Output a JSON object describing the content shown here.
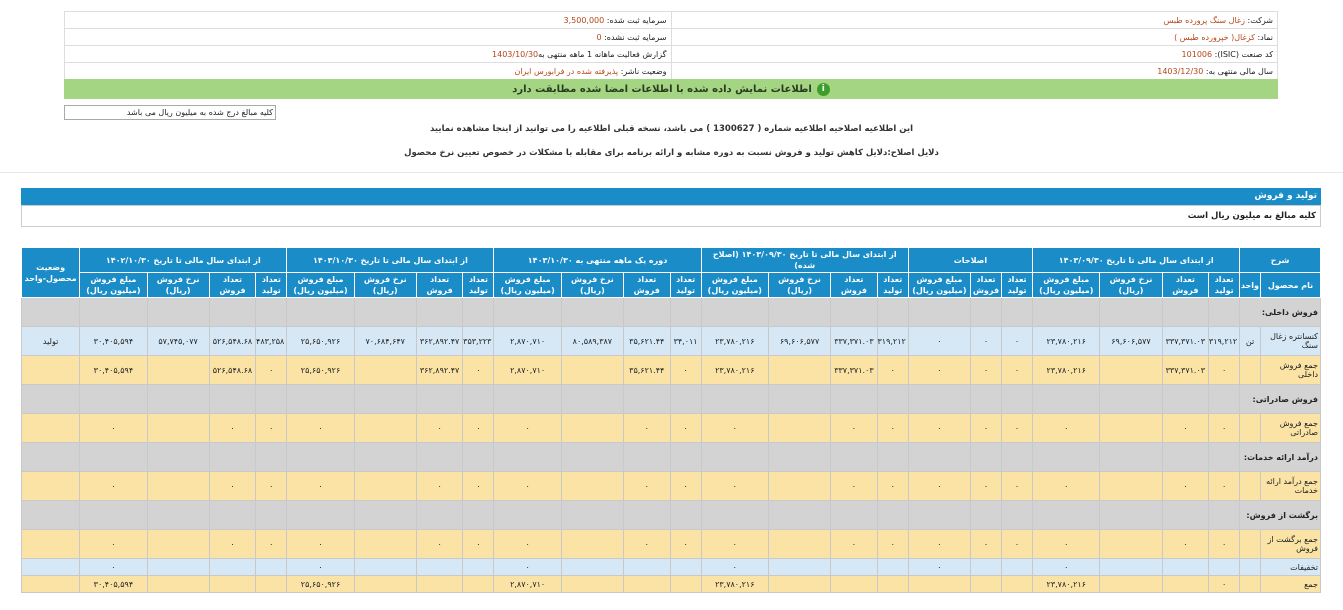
{
  "header": {
    "company_label": "شرکت:",
    "company_value": "زغال سنگ پرورده طبس",
    "capital_reg_label": "سرمایه ثبت شده:",
    "capital_reg_value": "3,500,000",
    "symbol_label": "نماد:",
    "symbol_value": "کزغال( خپرورده طبس )",
    "capital_unreg_label": "سرمایه ثبت نشده:",
    "capital_unreg_value": "0",
    "isic_label": "کد صنعت (ISIC):",
    "isic_value": "101006",
    "report_label": "گزارش فعالیت ماهانه 1 ماهه منتهی به",
    "report_value": "1403/10/30",
    "fiscal_label": "سال مالی منتهی به:",
    "fiscal_value": "1403/12/30",
    "status_label": "وضعیت ناشر:",
    "status_value": "پذیرفته شده در فرابورس ایران"
  },
  "notice": {
    "icon": "info-icon",
    "text": "اطلاعات نمایش داده شده با اطلاعات امضا شده مطابقت دارد"
  },
  "unit_box": "کلیه مبالغ درج شده به میلیون ریال می باشد",
  "correction_note": "این اطلاعیه اصلاحیه اطلاعیه شماره ( 1300627 ) می باشد، نسخه قبلی اطلاعیه را می توانید از اینجا مشاهده نمایید",
  "correction_reason": "دلایل اصلاح:دلایل کاهش تولید و فروش نسبت به دوره مشابه و ارائه برنامه برای مقابله با مشکلات در خصوص تعیین نرخ محصول",
  "section": {
    "title": "تولید و فروش",
    "subtitle": "کلیه مبالغ به میلیون ریال است"
  },
  "table": {
    "col_sharh": "شرح",
    "col_name": "نام محصول",
    "col_unit": "واحد",
    "groups": [
      "از ابتدای سال مالی تا تاریخ ۱۴۰۳/۰۹/۳۰",
      "اصلاحات",
      "از ابتدای سال مالی تا تاریخ ۱۴۰۳/۰۹/۳۰ (اصلاح شده)",
      "دوره یک ماهه منتهی به ۱۴۰۳/۱۰/۳۰",
      "از ابتدای سال مالی تا تاریخ ۱۴۰۳/۱۰/۳۰",
      "از ابتدای سال مالی تا تاریخ ۱۴۰۲/۱۰/۳۰",
      "وضعیت محصول-واحد"
    ],
    "sub4": [
      "تعداد تولید",
      "تعداد فروش",
      "نرخ فروش (ریال)",
      "مبلغ فروش (میلیون ریال)"
    ],
    "sub3": [
      "تعداد تولید",
      "تعداد فروش",
      "مبلغ فروش (میلیون ریال)"
    ],
    "rows": [
      {
        "kind": "group",
        "label": "فروش داخلی:",
        "cells": []
      },
      {
        "kind": "blue",
        "label": "کنسانتره زغال سنگ",
        "unit": "تن",
        "cells": [
          "۳۱۹,۲۱۲",
          "۳۳۷,۳۷۱.۰۳",
          "۶۹,۶۰۶,۵۷۷",
          "۲۳,۷۸۰,۲۱۶",
          "۰",
          "۰",
          "۰",
          "۳۱۹,۲۱۲",
          "۳۳۷,۳۷۱.۰۳",
          "۶۹,۶۰۶,۵۷۷",
          "۲۳,۷۸۰,۲۱۶",
          "۳۴,۰۱۱",
          "۳۵,۶۲۱.۴۴",
          "۸۰,۵۸۹,۳۸۷",
          "۲,۸۷۰,۷۱۰",
          "۳۵۳,۲۲۳",
          "۳۶۲,۸۹۲.۴۷",
          "۷۰,۶۸۴,۶۴۷",
          "۲۵,۶۵۰,۹۲۶",
          "۴۸۳,۲۵۸",
          "۵۲۶,۵۴۸.۶۸",
          "۵۷,۷۴۵,۰۷۷",
          "۳۰,۴۰۵,۵۹۴",
          "تولید"
        ]
      },
      {
        "kind": "yellow",
        "label": "جمع فروش داخلی",
        "unit": "",
        "cells": [
          "۰",
          "۳۳۷,۳۷۱.۰۳",
          "",
          "۲۳,۷۸۰,۲۱۶",
          "۰",
          "۰",
          "۰",
          "۰",
          "۳۳۷,۳۷۱.۰۳",
          "",
          "۲۳,۷۸۰,۲۱۶",
          "۰",
          "۳۵,۶۲۱.۴۴",
          "",
          "۲,۸۷۰,۷۱۰",
          "۰",
          "۳۶۲,۸۹۲.۴۷",
          "",
          "۲۵,۶۵۰,۹۲۶",
          "۰",
          "۵۲۶,۵۴۸.۶۸",
          "",
          "۳۰,۴۰۵,۵۹۴",
          ""
        ]
      },
      {
        "kind": "group",
        "label": "فروش صادراتی:",
        "cells": []
      },
      {
        "kind": "yellow",
        "label": "جمع فروش صادراتی",
        "unit": "",
        "cells": [
          "۰",
          "۰",
          "",
          "۰",
          "۰",
          "۰",
          "۰",
          "۰",
          "۰",
          "",
          "۰",
          "۰",
          "۰",
          "",
          "۰",
          "۰",
          "۰",
          "",
          "۰",
          "۰",
          "۰",
          "",
          "۰",
          ""
        ]
      },
      {
        "kind": "group",
        "label": "درآمد ارائه خدمات:",
        "cells": []
      },
      {
        "kind": "yellow",
        "label": "جمع درآمد ارائه خدمات",
        "unit": "",
        "cells": [
          "۰",
          "۰",
          "",
          "۰",
          "۰",
          "۰",
          "۰",
          "۰",
          "۰",
          "",
          "۰",
          "۰",
          "۰",
          "",
          "۰",
          "۰",
          "۰",
          "",
          "۰",
          "۰",
          "۰",
          "",
          "۰",
          ""
        ]
      },
      {
        "kind": "group",
        "label": "برگشت از فروش:",
        "cells": []
      },
      {
        "kind": "yellow",
        "label": "جمع برگشت از فروش",
        "unit": "",
        "cells": [
          "۰",
          "۰",
          "",
          "۰",
          "۰",
          "۰",
          "۰",
          "۰",
          "۰",
          "",
          "۰",
          "۰",
          "۰",
          "",
          "۰",
          "۰",
          "۰",
          "",
          "۰",
          "۰",
          "۰",
          "",
          "۰",
          ""
        ]
      },
      {
        "kind": "blue short",
        "label": "تخفیفات",
        "unit": "",
        "cells": [
          "",
          "",
          "",
          "۰",
          "",
          "",
          "۰",
          "",
          "",
          "",
          "۰",
          "",
          "",
          "",
          "۰",
          "",
          "",
          "",
          "۰",
          "",
          "",
          "",
          "۰",
          ""
        ]
      },
      {
        "kind": "yellow short",
        "label": "جمع",
        "unit": "",
        "cells": [
          "۰",
          "",
          "",
          "۲۳,۷۸۰,۲۱۶",
          "",
          "",
          "",
          "",
          "",
          "",
          "۲۳,۷۸۰,۲۱۶",
          "",
          "",
          "",
          "۲,۸۷۰,۷۱۰",
          "",
          "",
          "",
          "۲۵,۶۵۰,۹۲۶",
          "",
          "",
          "",
          "۳۰,۴۰۵,۵۹۴",
          ""
        ]
      }
    ]
  }
}
